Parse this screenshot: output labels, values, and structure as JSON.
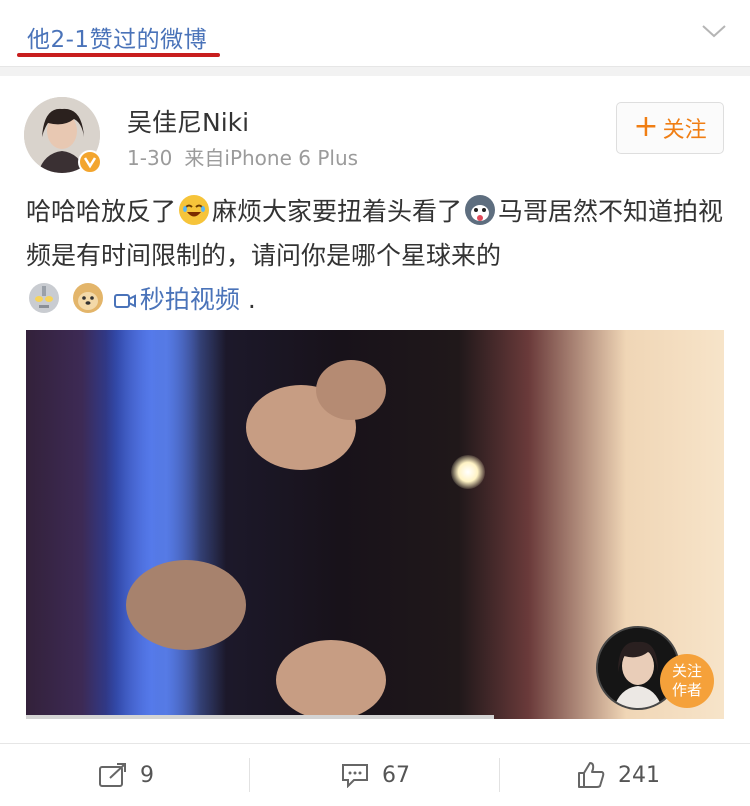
{
  "header": {
    "title": "他2-1赞过的微博"
  },
  "post": {
    "author": {
      "name": "吴佳尼Niki"
    },
    "meta": {
      "date": "1-30",
      "source": "来自iPhone 6 Plus"
    },
    "follow_label": "关注",
    "text": {
      "part1": "哈哈哈放反了",
      "part2": "麻烦大家要扭着头看了",
      "part3": "马哥居然不知道拍视频是有时间限制的，请问你是哪个星球来的",
      "video_link": "秒拍视频",
      "tail": "."
    },
    "video": {
      "follow_author_line1": "关注",
      "follow_author_line2": "作者",
      "progress": 0.67
    }
  },
  "footer": {
    "repost_count": "9",
    "comment_count": "67",
    "like_count": "241"
  },
  "colors": {
    "link": "#4a73b9",
    "accent_red": "#c81e1e",
    "follow_orange": "#f07e13",
    "badge_orange": "#f5a13a"
  },
  "icons": [
    "chevron-down-icon",
    "verified-badge-icon",
    "plus-icon",
    "laugh-emoji-icon",
    "husky-emoji-icon",
    "ultraman-emoji-icon",
    "doge-emoji-icon",
    "video-camera-icon",
    "repost-icon",
    "comment-icon",
    "like-icon"
  ]
}
